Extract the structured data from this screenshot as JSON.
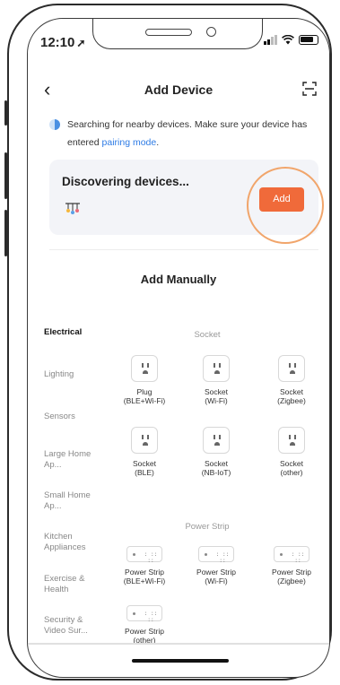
{
  "status_bar": {
    "time": "12:10",
    "location_glyph": "➚"
  },
  "header": {
    "title": "Add Device",
    "back_icon": "‹",
    "scan_icon": "scan-icon"
  },
  "notice": {
    "text": "Searching for nearby devices. Make sure your device has entered ",
    "link": "pairing mode",
    "end": "."
  },
  "discovering": {
    "title": "Discovering devices...",
    "add_label": "Add"
  },
  "manual": {
    "title": "Add Manually"
  },
  "categories": [
    {
      "label": "Electrical",
      "active": true
    },
    {
      "label": "Lighting",
      "active": false
    },
    {
      "label": "Sensors",
      "active": false
    },
    {
      "label": "Large Home Ap...",
      "active": false
    },
    {
      "label": "Small Home Ap...",
      "active": false
    },
    {
      "label": "Kitchen Appliances",
      "active": false
    },
    {
      "label": "Exercise & Health",
      "active": false
    },
    {
      "label": "Security & Video Sur...",
      "active": false
    }
  ],
  "sections": {
    "socket": "Socket",
    "power_strip": "Power Strip"
  },
  "devices": {
    "socket": [
      {
        "label": "Plug\n(BLE+Wi-Fi)"
      },
      {
        "label": "Socket\n(Wi-Fi)"
      },
      {
        "label": "Socket\n(Zigbee)"
      },
      {
        "label": "Socket\n(BLE)"
      },
      {
        "label": "Socket\n(NB-IoT)"
      },
      {
        "label": "Socket\n(other)"
      }
    ],
    "power_strip": [
      {
        "label": "Power Strip\n(BLE+Wi-Fi)"
      },
      {
        "label": "Power Strip\n(Wi-Fi)"
      },
      {
        "label": "Power Strip\n(Zigbee)"
      },
      {
        "label": "Power Strip\n(other)"
      }
    ]
  },
  "colors": {
    "accent": "#f06a3a",
    "link": "#2d7be5",
    "card_bg": "#f3f4f8"
  }
}
